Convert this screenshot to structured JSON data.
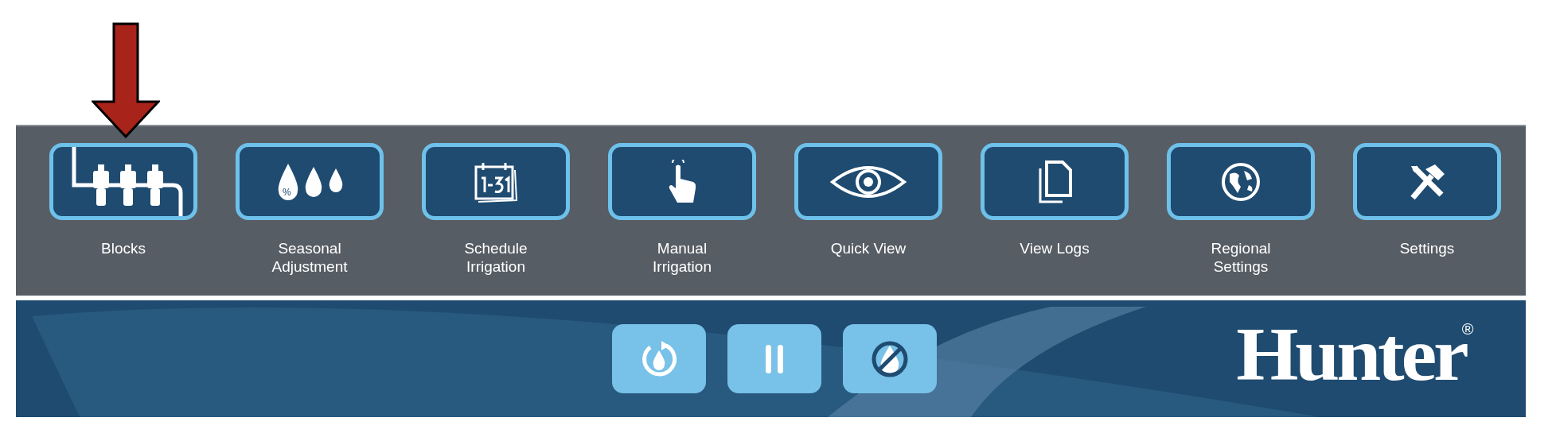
{
  "menu": [
    {
      "label": "Blocks",
      "kind": "valves"
    },
    {
      "label": "Seasonal\nAdjustment",
      "kind": "drops",
      "icon_text": "%"
    },
    {
      "label": "Schedule\nIrrigation",
      "kind": "calendar"
    },
    {
      "label": "Manual\nIrrigation",
      "kind": "hand"
    },
    {
      "label": "Quick View",
      "kind": "eye"
    },
    {
      "label": "View Logs",
      "kind": "docs"
    },
    {
      "label": "Regional\nSettings",
      "kind": "globe"
    },
    {
      "label": "Settings",
      "kind": "tools"
    }
  ],
  "controls": [
    {
      "kind": "run"
    },
    {
      "kind": "pause"
    },
    {
      "kind": "off"
    }
  ],
  "logo": {
    "text": "Hunter",
    "mark": "®"
  },
  "annotation": {
    "kind": "arrow"
  }
}
